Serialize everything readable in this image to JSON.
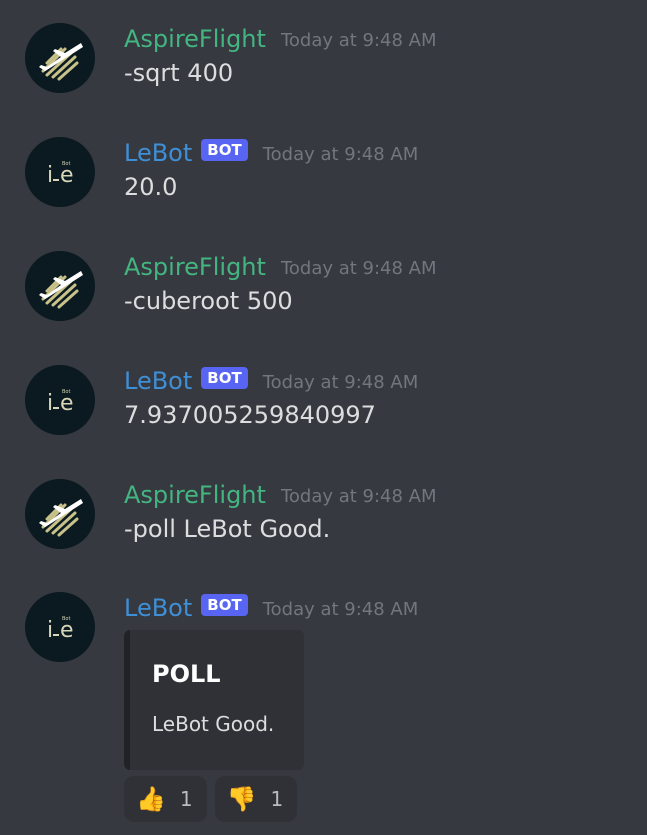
{
  "messages": [
    {
      "username": "AspireFlight",
      "timestamp": "Today at 9:48 AM",
      "text": "-sqrt 400"
    },
    {
      "username": "LeBot",
      "bot_tag": "BOT",
      "timestamp": "Today at 9:48 AM",
      "text": "20.0"
    },
    {
      "username": "AspireFlight",
      "timestamp": "Today at 9:48 AM",
      "text": "-cuberoot 500"
    },
    {
      "username": "LeBot",
      "bot_tag": "BOT",
      "timestamp": "Today at 9:48 AM",
      "text": "7.937005259840997"
    },
    {
      "username": "AspireFlight",
      "timestamp": "Today at 9:48 AM",
      "text": "-poll LeBot Good."
    },
    {
      "username": "LeBot",
      "bot_tag": "BOT",
      "timestamp": "Today at 9:48 AM",
      "embed": {
        "title": "POLL",
        "description": "LeBot Good."
      },
      "reactions": [
        {
          "emoji": "👍",
          "count": "1",
          "icon": "thumbs-up-icon"
        },
        {
          "emoji": "👎",
          "count": "1",
          "icon": "thumbs-down-icon"
        }
      ]
    }
  ],
  "avatars": {
    "aspireflight": {
      "icon": "plane-stripes-icon"
    },
    "lebot": {
      "icon": "lebot-logo-icon",
      "logo_text": "LE",
      "logo_small": "Bot"
    }
  },
  "colors": {
    "background": "#36393f",
    "user_green": "#43b581",
    "bot_blue": "#3f8fd6",
    "bot_tag": "#5865f2",
    "timestamp": "#72767d",
    "embed_bg": "#2f3136"
  }
}
